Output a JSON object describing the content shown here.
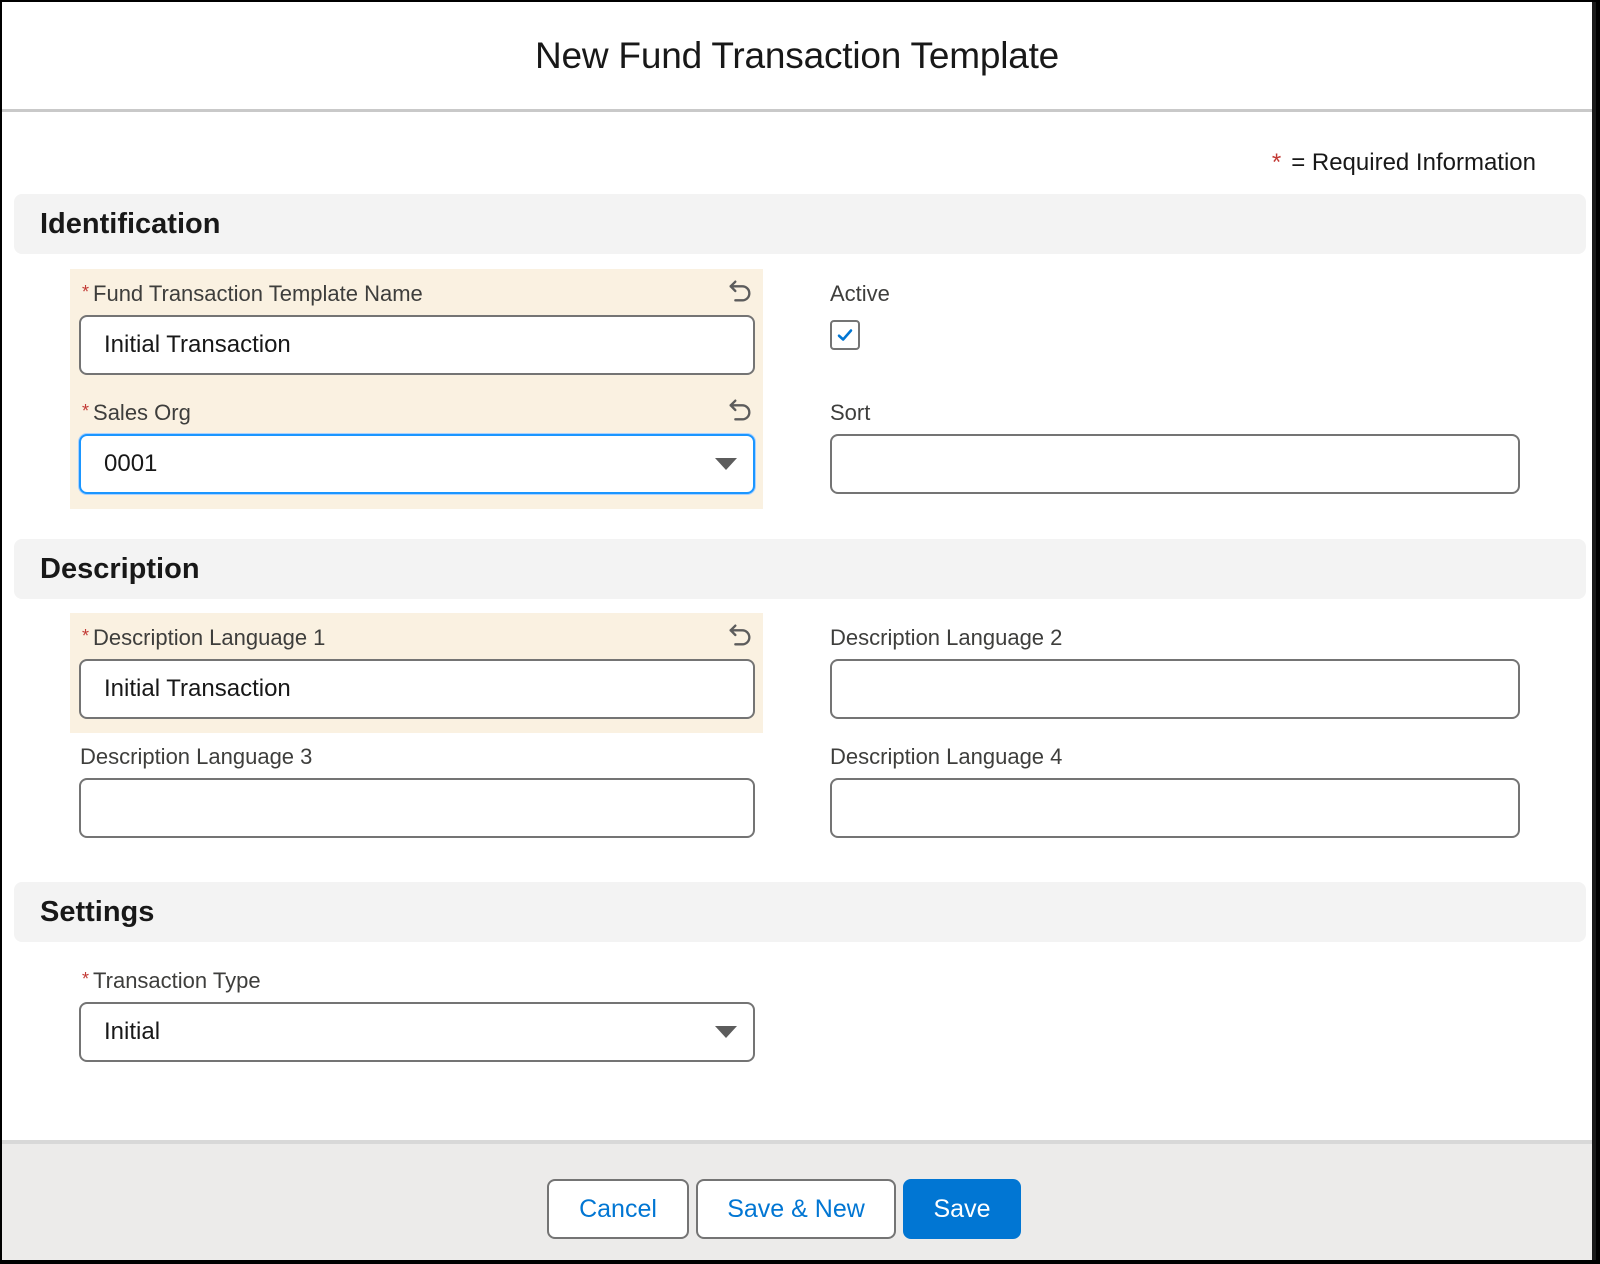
{
  "modal": {
    "title": "New Fund Transaction Template",
    "required_legend": {
      "asterisk": "*",
      "text": "= Required Information"
    }
  },
  "colors": {
    "brand": "#0176d3",
    "required": "#c23934",
    "highlight": "#faf1e1",
    "focus": "#1b96ff"
  },
  "sections": {
    "identification": {
      "title": "Identification",
      "fields": {
        "template_name": {
          "label": "Fund Transaction Template Name",
          "required": "*",
          "value": "Initial Transaction",
          "changed": true
        },
        "active": {
          "label": "Active",
          "checked": true
        },
        "sales_org": {
          "label": "Sales Org",
          "required": "*",
          "value": "0001",
          "changed": true,
          "focused": true
        },
        "sort": {
          "label": "Sort",
          "value": ""
        }
      }
    },
    "description": {
      "title": "Description",
      "fields": {
        "lang1": {
          "label": "Description Language 1",
          "required": "*",
          "value": "Initial Transaction",
          "changed": true
        },
        "lang2": {
          "label": "Description Language 2",
          "value": ""
        },
        "lang3": {
          "label": "Description Language 3",
          "value": ""
        },
        "lang4": {
          "label": "Description Language 4",
          "value": ""
        }
      }
    },
    "settings": {
      "title": "Settings",
      "fields": {
        "transaction_type": {
          "label": "Transaction Type",
          "required": "*",
          "value": "Initial"
        }
      }
    }
  },
  "footer": {
    "cancel_label": "Cancel",
    "save_new_label": "Save & New",
    "save_label": "Save"
  },
  "icons": {
    "undo": "undo-icon",
    "caret": "chevron-down-icon",
    "check": "check-icon"
  }
}
